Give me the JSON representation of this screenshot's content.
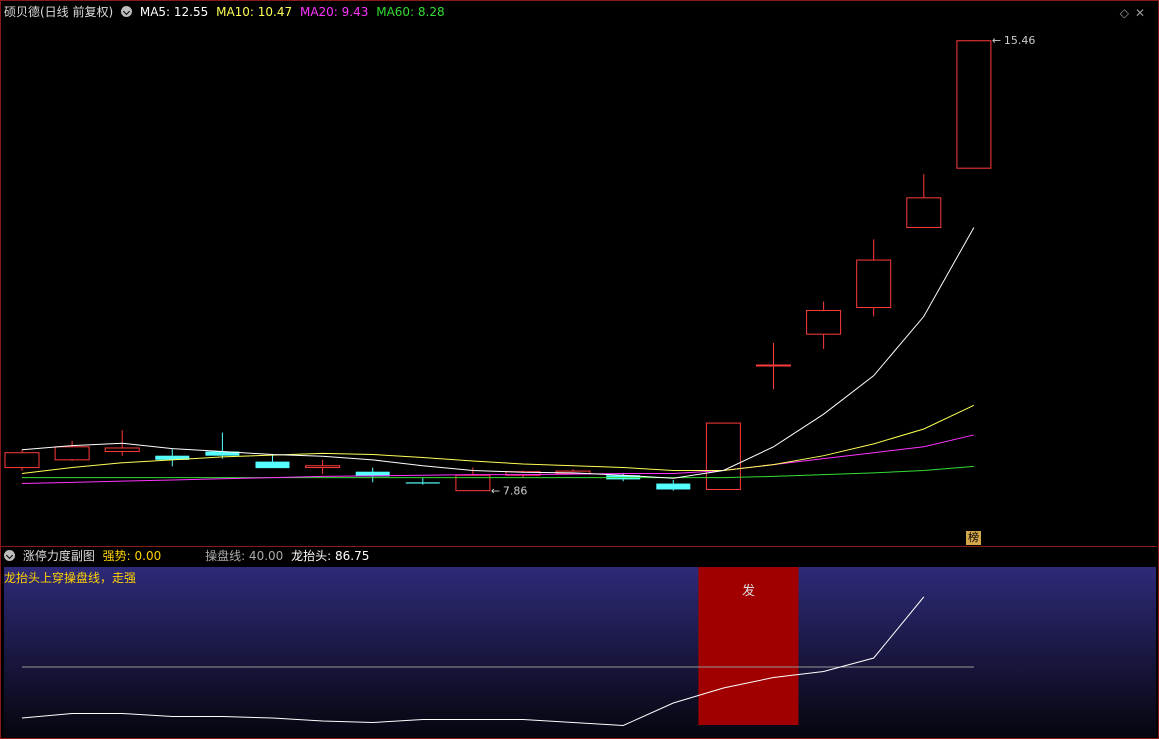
{
  "main_header": {
    "stock_title": "硕贝德(日线 前复权)",
    "ma5": "MA5: 12.55",
    "ma10": "MA10: 10.47",
    "ma20": "MA20: 9.43",
    "ma60": "MA60: 8.28"
  },
  "sub_header": {
    "indicator_name": "涨停力度副图",
    "strength": "强势: 0.00",
    "trade_line": "操盘线: 40.00",
    "dragon_head": "龙抬头: 86.75"
  },
  "sub_note": "龙抬头上穿操盘线，走强",
  "bang_label": "榜",
  "signal_label": "发",
  "colors": {
    "up": "#ff3b3b",
    "down": "#55ffff",
    "ma5": "#ffffff",
    "ma10": "#ffff55",
    "ma20": "#ff33ff",
    "ma60": "#33dd33",
    "border": "#8a1a1a",
    "signal": "#a00000"
  },
  "chart_data": [
    {
      "type": "candlestick",
      "title": "硕贝德(日线 前复权)",
      "price_range": [
        7.5,
        15.8
      ],
      "candles": [
        {
          "o": 8.25,
          "h": 8.55,
          "l": 8.2,
          "c": 8.5
        },
        {
          "o": 8.38,
          "h": 8.7,
          "l": 8.36,
          "c": 8.6
        },
        {
          "o": 8.52,
          "h": 8.88,
          "l": 8.45,
          "c": 8.58
        },
        {
          "o": 8.45,
          "h": 8.56,
          "l": 8.27,
          "c": 8.38
        },
        {
          "o": 8.52,
          "h": 8.84,
          "l": 8.4,
          "c": 8.45
        },
        {
          "o": 8.35,
          "h": 8.48,
          "l": 8.24,
          "c": 8.24
        },
        {
          "o": 8.25,
          "h": 8.38,
          "l": 8.14,
          "c": 8.28
        },
        {
          "o": 8.18,
          "h": 8.25,
          "l": 8.0,
          "c": 8.1
        },
        {
          "o": 8.0,
          "h": 8.08,
          "l": 7.96,
          "c": 7.98
        },
        {
          "o": 7.86,
          "h": 8.25,
          "l": 7.86,
          "c": 8.12
        },
        {
          "o": 8.12,
          "h": 8.2,
          "l": 8.08,
          "c": 8.18
        },
        {
          "o": 8.15,
          "h": 8.22,
          "l": 8.13,
          "c": 8.19
        },
        {
          "o": 8.12,
          "h": 8.16,
          "l": 8.02,
          "c": 8.05
        },
        {
          "o": 7.98,
          "h": 8.04,
          "l": 7.86,
          "c": 7.88
        },
        {
          "o": 7.88,
          "h": 9.0,
          "l": 7.88,
          "c": 9.0
        },
        {
          "o": 9.98,
          "h": 10.35,
          "l": 9.57,
          "c": 9.98
        },
        {
          "o": 10.5,
          "h": 11.05,
          "l": 10.25,
          "c": 10.9
        },
        {
          "o": 10.95,
          "h": 12.1,
          "l": 10.8,
          "c": 11.75
        },
        {
          "o": 12.3,
          "h": 13.2,
          "l": 12.3,
          "c": 12.8
        },
        {
          "o": 13.3,
          "h": 15.46,
          "l": 13.3,
          "c": 15.45
        }
      ],
      "ma5": [
        8.55,
        8.62,
        8.66,
        8.57,
        8.52,
        8.47,
        8.44,
        8.38,
        8.28,
        8.2,
        8.17,
        8.16,
        8.12,
        8.07,
        8.2,
        8.6,
        9.15,
        9.8,
        10.8,
        12.3
      ],
      "ma10": [
        8.15,
        8.25,
        8.33,
        8.38,
        8.43,
        8.46,
        8.49,
        8.47,
        8.42,
        8.36,
        8.31,
        8.28,
        8.25,
        8.2,
        8.2,
        8.3,
        8.45,
        8.65,
        8.9,
        9.3
      ],
      "ma20": [
        7.98,
        8.0,
        8.02,
        8.04,
        8.06,
        8.08,
        8.1,
        8.11,
        8.12,
        8.13,
        8.13,
        8.14,
        8.15,
        8.15,
        8.2,
        8.3,
        8.4,
        8.5,
        8.6,
        8.8
      ],
      "ma60": [
        8.08,
        8.08,
        8.08,
        8.08,
        8.08,
        8.08,
        8.08,
        8.08,
        8.08,
        8.08,
        8.08,
        8.08,
        8.08,
        8.08,
        8.08,
        8.1,
        8.13,
        8.16,
        8.2,
        8.27
      ],
      "annotations": [
        {
          "label": "15.46",
          "candle": 19,
          "price": 15.46
        },
        {
          "label": "7.86",
          "candle": 9,
          "price": 7.86
        }
      ]
    },
    {
      "type": "line",
      "title": "涨停力度副图",
      "ylim": [
        0,
        100
      ],
      "trade_line": 40,
      "dragon_head": [
        6,
        9,
        9,
        7,
        7,
        6,
        4,
        3,
        5,
        5,
        5,
        3,
        1,
        16,
        26,
        33,
        37,
        46,
        86.75
      ],
      "signal_candles": [
        14,
        15
      ]
    }
  ]
}
